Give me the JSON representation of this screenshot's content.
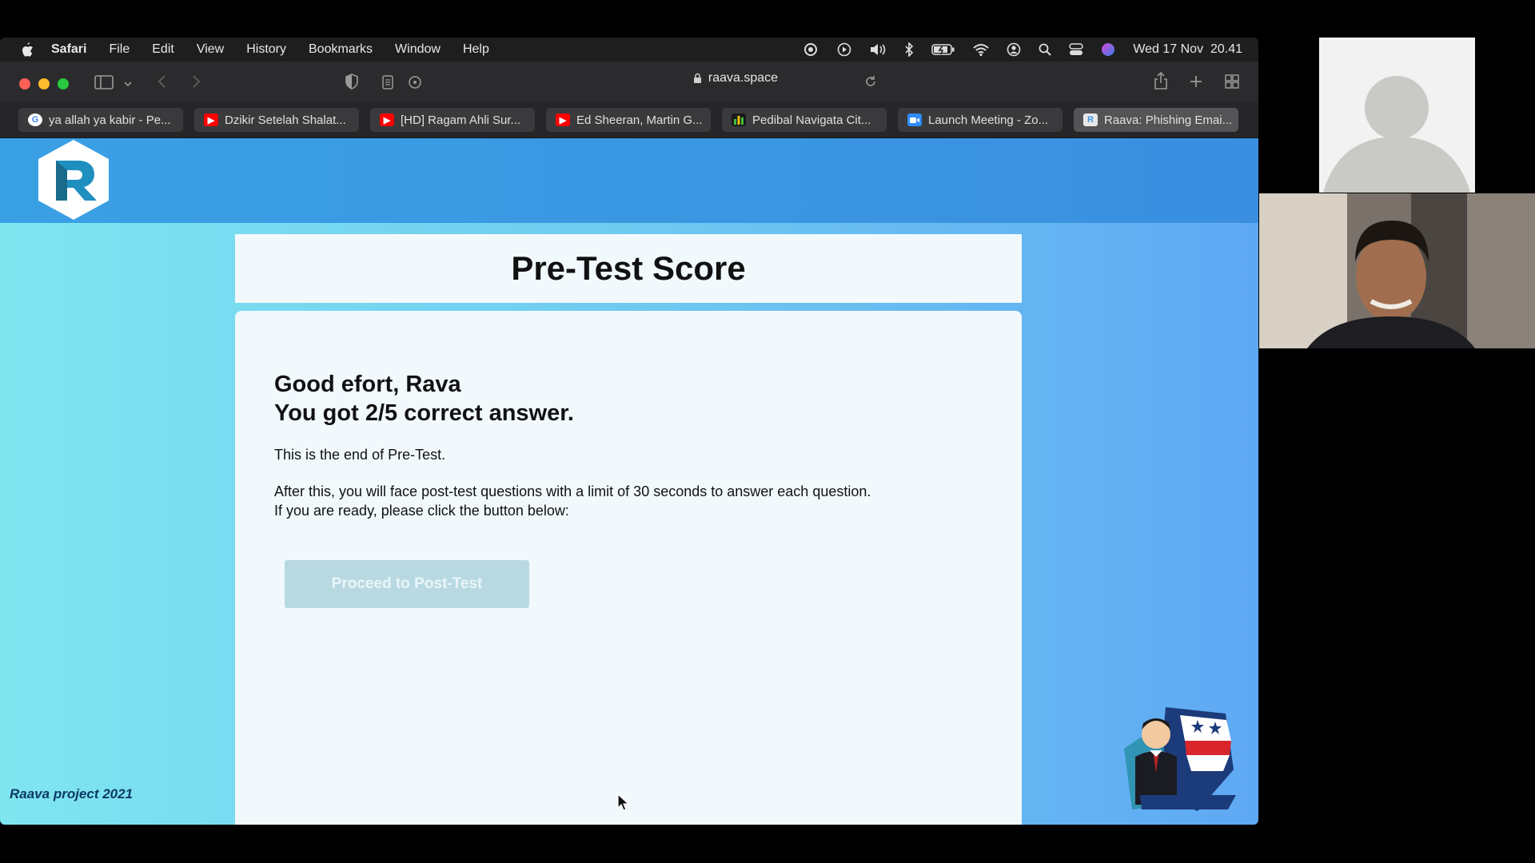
{
  "menubar": {
    "app_name": "Safari",
    "items": [
      "File",
      "Edit",
      "View",
      "History",
      "Bookmarks",
      "Window",
      "Help"
    ],
    "clock": "Wed 17 Nov  20.41"
  },
  "toolbar": {
    "url": "raava.space"
  },
  "tabs": [
    {
      "label": "ya allah ya kabir - Pe...",
      "icon": "google-icon",
      "color": "#ffffff"
    },
    {
      "label": "Dzikir Setelah Shalat...",
      "icon": "youtube-icon",
      "color": "#ff0000"
    },
    {
      "label": "[HD] Ragam Ahli Sur...",
      "icon": "youtube-icon",
      "color": "#ff0000"
    },
    {
      "label": "Ed Sheeran, Martin G...",
      "icon": "youtube-icon",
      "color": "#ff0000"
    },
    {
      "label": "Pedibal Navigata Cit...",
      "icon": "chart-icon",
      "color": "#1a1a1a"
    },
    {
      "label": "Launch Meeting - Zo...",
      "icon": "zoom-icon",
      "color": "#2d8cff"
    },
    {
      "label": "Raava: Phishing Emai...",
      "icon": "raava-icon",
      "color": "#dddddd",
      "active": true
    }
  ],
  "page": {
    "title": "Pre-Test Score",
    "greeting": "Good efort, Rava",
    "score_line": "You got 2/5 correct answer.",
    "end_text": "This is the end of Pre-Test.",
    "instructions": "After this, you will face post-test questions with a limit of 30 seconds to answer each question. If you are ready, please click the button below:",
    "button_label": "Proceed to Post-Test",
    "footer": "Raava project 2021"
  },
  "colors": {
    "header": "#3a97e3",
    "card": "#f1f9fd",
    "button": "#b8d9e2"
  }
}
